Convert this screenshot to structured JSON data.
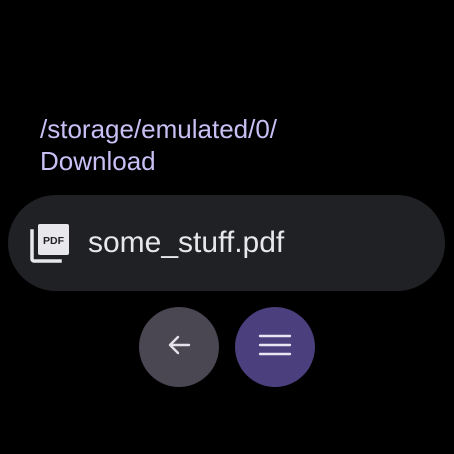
{
  "path": {
    "line1": "/storage/emulated/0/",
    "line2": "Download"
  },
  "file": {
    "name": "some_stuff.pdf",
    "icon": "pdf-file-icon",
    "icon_label": "PDF"
  },
  "buttons": {
    "back_icon": "arrow-left-icon",
    "menu_icon": "hamburger-menu-icon"
  },
  "colors": {
    "path_text": "#c9bff5",
    "chip_bg": "#202124",
    "back_bg": "#4a4652",
    "menu_bg": "#4b3f7d"
  }
}
